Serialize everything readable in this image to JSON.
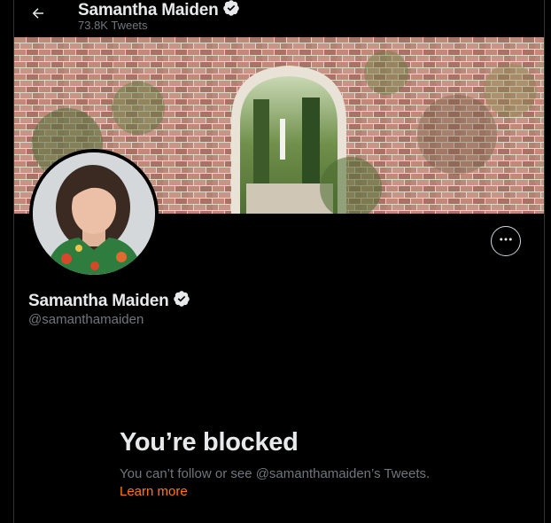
{
  "header": {
    "back_icon": "arrow-left-icon",
    "name": "Samantha Maiden",
    "tweet_count": "73.8K Tweets",
    "verified_icon": "verified-badge-icon"
  },
  "profile": {
    "name": "Samantha Maiden",
    "handle": "@samanthamaiden",
    "more_icon": "more-horizontal-icon"
  },
  "blocked": {
    "title": "You’re blocked",
    "message": "You can’t follow or see @samanthamaiden’s Tweets.",
    "learn_more": "Learn more"
  },
  "colors": {
    "background": "#000000",
    "text_primary": "#e7e9ea",
    "text_secondary": "#71767b",
    "link": "#ff7a00",
    "verified": "#e7e9ea"
  }
}
